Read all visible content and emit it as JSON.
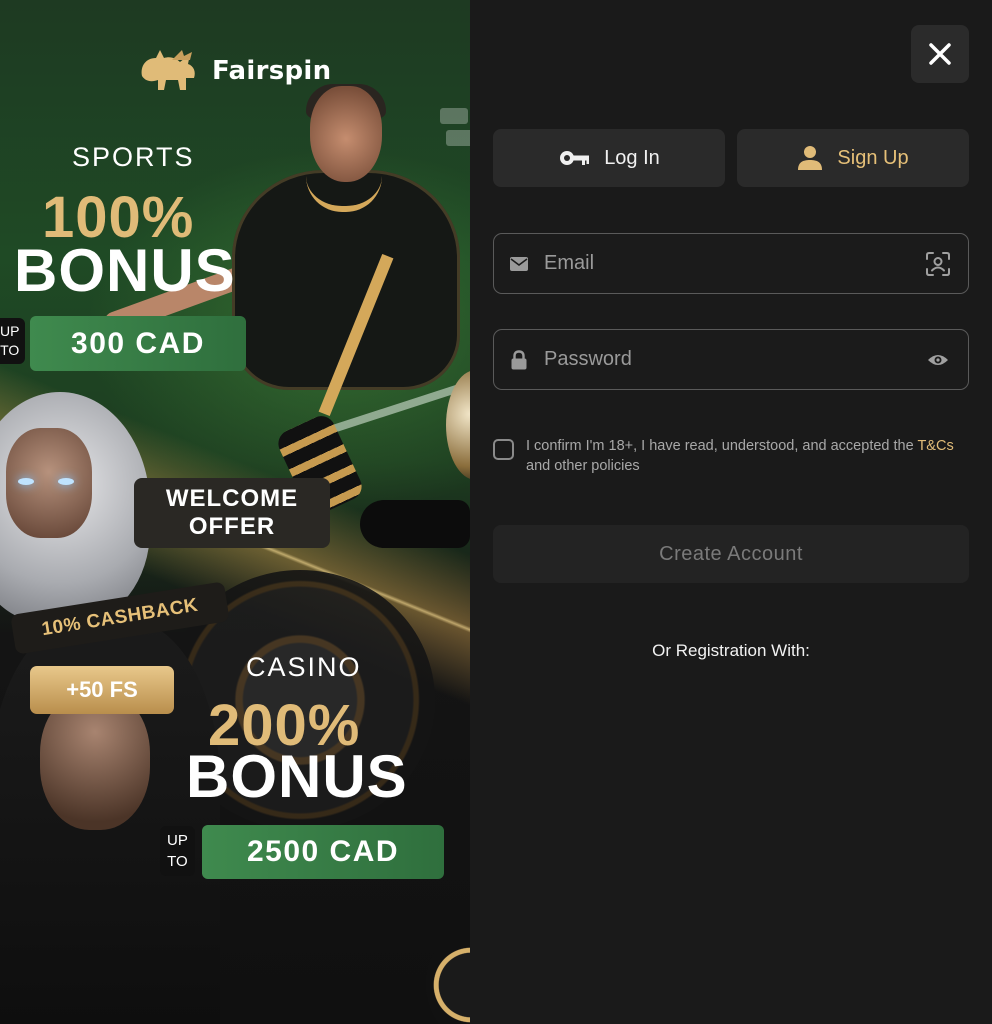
{
  "brand": {
    "name": "Fairspin"
  },
  "promo": {
    "sports_label": "SPORTS",
    "sports_percent": "100%",
    "sports_bonus": "BONUS",
    "sports_upto_line1": "UP",
    "sports_upto_line2": "TO",
    "sports_amount": "300 CAD",
    "welcome_line1": "WELCOME",
    "welcome_line2": "OFFER",
    "cashback": "10% CASHBACK",
    "free_spins": "+50 FS",
    "casino_label": "CASINO",
    "casino_percent": "200%",
    "casino_bonus": "BONUS",
    "casino_upto_line1": "UP",
    "casino_upto_line2": "TO",
    "casino_amount": "2500 CAD"
  },
  "tabs": [
    {
      "label": "Log In",
      "icon": "key-icon",
      "active": false
    },
    {
      "label": "Sign Up",
      "icon": "user-icon",
      "active": true
    }
  ],
  "form": {
    "email_placeholder": "Email",
    "email_value": "",
    "password_placeholder": "Password",
    "password_value": "",
    "confirm_text_before": "I confirm I'm 18+, I have read, understood, and accepted the",
    "confirm_link": "T&Cs",
    "confirm_text_after": "and other policies",
    "confirm_checked": false,
    "submit_label": "Create Account",
    "or_text": "Or Registration With:"
  },
  "icons": {
    "close": "close-icon",
    "email": "envelope-icon",
    "email_right": "face-scan-icon",
    "password": "lock-icon",
    "password_right": "eye-icon"
  },
  "colors": {
    "accent": "#e0bb78",
    "panel": "#1a1a1a",
    "tab_bg": "#2a2a2a",
    "promo_green": "#3f8a4e"
  }
}
